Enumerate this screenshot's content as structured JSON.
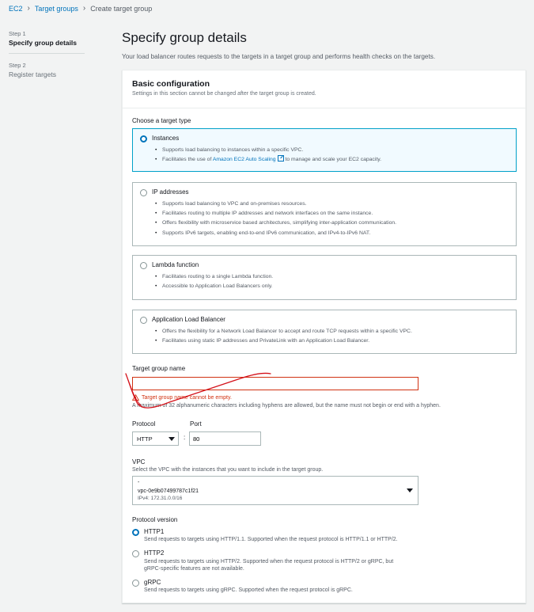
{
  "breadcrumb": {
    "ec2": "EC2",
    "target_groups": "Target groups",
    "current": "Create target group"
  },
  "steps": [
    {
      "num": "Step 1",
      "label": "Specify group details"
    },
    {
      "num": "Step 2",
      "label": "Register targets"
    }
  ],
  "page": {
    "title": "Specify group details",
    "description": "Your load balancer routes requests to the targets in a target group and performs health checks on the targets."
  },
  "basic_config": {
    "title": "Basic configuration",
    "subtitle": "Settings in this section cannot be changed after the target group is created.",
    "target_type_label": "Choose a target type"
  },
  "target_types": {
    "instances": {
      "title": "Instances",
      "b1": "Supports load balancing to instances within a specific VPC.",
      "b2_pre": "Facilitates the use of",
      "b2_link": "Amazon EC2 Auto Scaling",
      "b2_post": "to manage and scale your EC2 capacity."
    },
    "ip": {
      "title": "IP addresses",
      "b1": "Supports load balancing to VPC and on-premises resources.",
      "b2": "Facilitates routing to multiple IP addresses and network interfaces on the same instance.",
      "b3": "Offers flexibility with microservice based architectures, simplifying inter-application communication.",
      "b4": "Supports IPv6 targets, enabling end-to-end IPv6 communication, and IPv4-to-IPv6 NAT."
    },
    "lambda": {
      "title": "Lambda function",
      "b1": "Facilitates routing to a single Lambda function.",
      "b2": "Accessible to Application Load Balancers only."
    },
    "alb": {
      "title": "Application Load Balancer",
      "b1": "Offers the flexibility for a Network Load Balancer to accept and route TCP requests within a specific VPC.",
      "b2": "Facilitates using static IP addresses and PrivateLink with an Application Load Balancer."
    }
  },
  "target_group_name": {
    "label": "Target group name",
    "value": "",
    "error": "Target group name cannot be empty.",
    "hint": "A maximum of 32 alphanumeric characters including hyphens are allowed, but the name must not begin or end with a hyphen."
  },
  "protocol": {
    "label": "Protocol",
    "value": "HTTP"
  },
  "port": {
    "label": "Port",
    "value": "80",
    "separator": ":"
  },
  "vpc": {
    "label": "VPC",
    "description": "Select the VPC with the instances that you want to include in the target group.",
    "line1": "-",
    "line2": "vpc-0e9b07499787c1f21",
    "line3": "IPv4: 172.31.0.0/16"
  },
  "protocol_version": {
    "label": "Protocol version",
    "http1": {
      "title": "HTTP1",
      "desc": "Send requests to targets using HTTP/1.1. Supported when the request protocol is HTTP/1.1 or HTTP/2."
    },
    "http2": {
      "title": "HTTP2",
      "desc1": "Send requests to targets using HTTP/2. Supported when the request protocol is HTTP/2 or gRPC, but",
      "desc2": "gRPC-specific features are not available."
    },
    "grpc": {
      "title": "gRPC",
      "desc": "Send requests to targets using gRPC. Supported when the request protocol is gRPC."
    }
  },
  "colors": {
    "link": "#0073bb",
    "error": "#d13212",
    "selected_border": "#00a1c9",
    "selected_bg": "#f1faff",
    "annotation": "#d4111a"
  }
}
